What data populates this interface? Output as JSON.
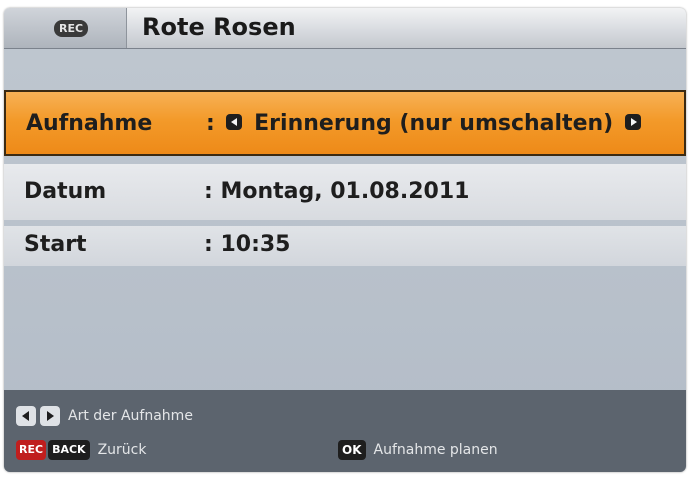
{
  "header": {
    "rec_badge": "REC",
    "title": "Rote Rosen"
  },
  "fields": {
    "aufnahme": {
      "label": "Aufnahme",
      "separator": ":",
      "value": "Erinnerung (nur umschalten)"
    },
    "datum": {
      "label": "Datum",
      "value": ": Montag, 01.08.2011"
    },
    "start": {
      "label": "Start",
      "value": ": 10:35"
    }
  },
  "footer": {
    "art_hint": "Art der Aufnahme",
    "rec_key": "REC",
    "back_key": "BACK",
    "back_hint": "Zurück",
    "ok_key": "OK",
    "ok_hint": "Aufnahme planen"
  },
  "colors": {
    "highlight": "#f39a2a",
    "panel": "#b3bcc7",
    "footer": "#5c646e",
    "rec": "#c01e1e"
  },
  "icons": {
    "left": "arrow-left-icon",
    "right": "arrow-right-icon"
  }
}
